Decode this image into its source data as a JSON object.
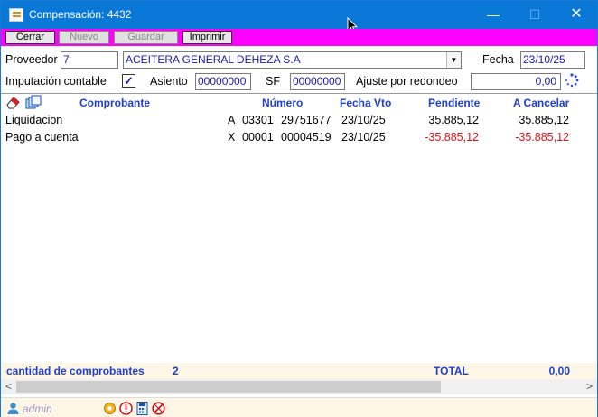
{
  "window": {
    "title": "Compensación: 4432",
    "controls": {
      "minimize": "—",
      "maximize": "☐",
      "close": "✕"
    }
  },
  "toolbar": {
    "close_label": "Cerrar",
    "new_label": "Nuevo",
    "save_label": "Guardar",
    "print_label": "Imprimir"
  },
  "form": {
    "supplier_label": "Proveedor",
    "supplier_code": "7",
    "supplier_name": "ACEITERA GENERAL DEHEZA S.A",
    "date_label": "Fecha",
    "date_value": "23/10/25",
    "imputation_label": "Imputación contable",
    "imputation_checked": true,
    "check_mark": "✓",
    "entry_label": "Asiento",
    "entry_value": "00000000",
    "sf_label": "SF",
    "sf_value": "00000000",
    "rounding_label": "Ajuste por redondeo",
    "rounding_value": "0,00"
  },
  "table": {
    "headers": {
      "voucher": "Comprobante",
      "number": "Número",
      "due_date": "Fecha Vto",
      "pending": "Pendiente",
      "to_cancel": "A Cancelar"
    },
    "rows": [
      {
        "voucher": "Liquidacion",
        "letter": "A",
        "point": "03301",
        "number": "29751677",
        "due_date": "23/10/25",
        "pending": "35.885,12",
        "to_cancel": "35.885,12",
        "negative": false
      },
      {
        "voucher": "Pago a cuenta",
        "letter": "X",
        "point": "00001",
        "number": "00004519",
        "due_date": "23/10/25",
        "pending": "-35.885,12",
        "to_cancel": "-35.885,12",
        "negative": true
      }
    ]
  },
  "footer": {
    "count_label": "cantidad de comprobantes",
    "count_value": "2",
    "total_label": "TOTAL",
    "total_value": "0,00"
  },
  "status": {
    "user": "admin"
  },
  "colors": {
    "titlebar": "#0a78d7",
    "toolbar": "#ff00ff",
    "header_text": "#1f3fd4",
    "negative": "#e0101a"
  }
}
